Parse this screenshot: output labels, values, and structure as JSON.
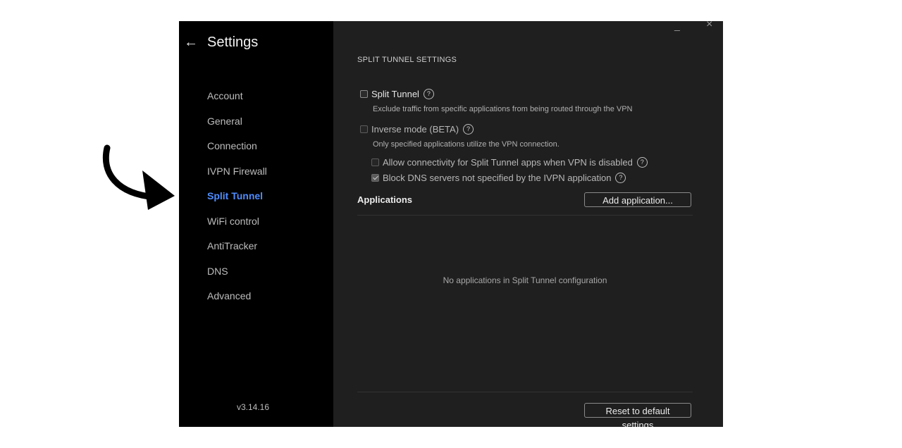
{
  "sidebar": {
    "back_icon": "arrow-left-icon",
    "title": "Settings",
    "items": [
      {
        "label": "Account"
      },
      {
        "label": "General"
      },
      {
        "label": "Connection"
      },
      {
        "label": "IVPN Firewall"
      },
      {
        "label": "Split Tunnel",
        "active": true
      },
      {
        "label": "WiFi control"
      },
      {
        "label": "AntiTracker"
      },
      {
        "label": "DNS"
      },
      {
        "label": "Advanced"
      }
    ],
    "version": "v3.14.16",
    "active_color": "#4f8dff"
  },
  "window_controls": {
    "minimize": "_",
    "close": "×"
  },
  "split_tunnel": {
    "section_title": "SPLIT TUNNEL SETTINGS",
    "split_tunnel_option": {
      "label": "Split Tunnel",
      "checked": false,
      "description": "Exclude traffic from specific applications from being routed through the VPN"
    },
    "inverse_mode_option": {
      "label": "Inverse mode (BETA)",
      "checked": false,
      "description": "Only specified applications utilize the VPN connection."
    },
    "allow_connectivity_option": {
      "label": "Allow connectivity for Split Tunnel apps when VPN is disabled",
      "checked": false
    },
    "block_dns_option": {
      "label": "Block DNS servers not specified by the IVPN application",
      "checked": true
    },
    "help_glyph": "?"
  },
  "applications": {
    "label": "Applications",
    "add_button": "Add application...",
    "empty_message": "No applications in Split Tunnel configuration"
  },
  "footer": {
    "reset_button": "Reset to default settings"
  }
}
